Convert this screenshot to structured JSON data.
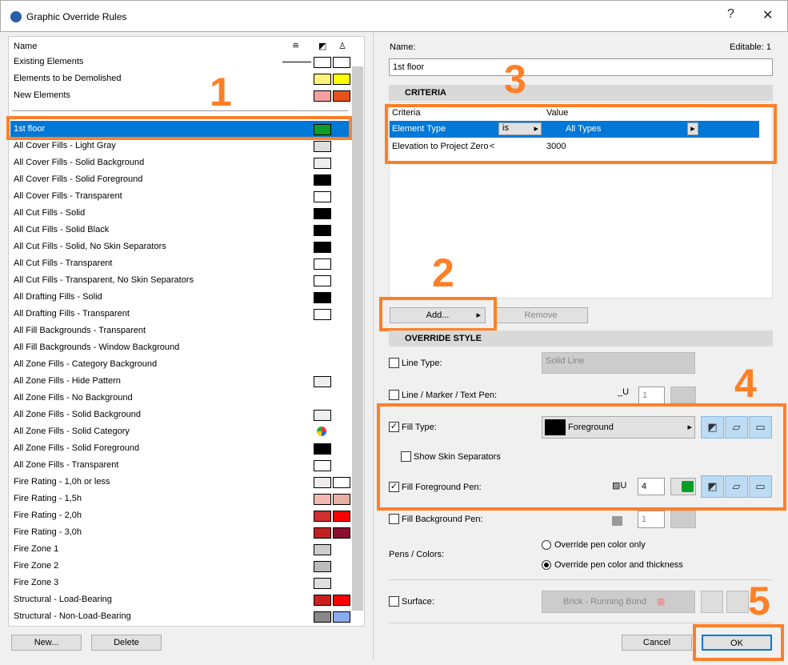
{
  "window": {
    "title": "Graphic Override Rules",
    "help": "?",
    "close": "✕"
  },
  "list": {
    "header": {
      "name": "Name"
    },
    "items": [
      {
        "label": "Existing Elements",
        "s1": "#ffffff",
        "s2": "#ffffff",
        "line": true
      },
      {
        "label": "Elements to be Demolished",
        "s1": "#fff27a",
        "s2": "#ffff00"
      },
      {
        "label": "New Elements",
        "s1": "#f5a0a0",
        "s2": "#e8521a"
      },
      {
        "label": "1st floor",
        "s1": "#0a9e28",
        "selected": true
      },
      {
        "label": "All Cover Fills - Light Gray",
        "s1": "#dddddd"
      },
      {
        "label": "All Cover Fills - Solid Background",
        "s1": "#eeeeee"
      },
      {
        "label": "All Cover Fills - Solid Foreground",
        "s1": "#000000"
      },
      {
        "label": "All Cover Fills - Transparent",
        "s1": "#ffffff"
      },
      {
        "label": "All Cut Fills - Solid",
        "s1": "#000000"
      },
      {
        "label": "All Cut Fills - Solid Black",
        "s1": "#000000"
      },
      {
        "label": "All Cut Fills - Solid, No Skin Separators",
        "s1": "#000000"
      },
      {
        "label": "All Cut Fills - Transparent",
        "s1": "#ffffff"
      },
      {
        "label": "All Cut Fills - Transparent, No Skin Separators",
        "s1": "#ffffff"
      },
      {
        "label": "All Drafting Fills - Solid",
        "s1": "#000000"
      },
      {
        "label": "All Drafting Fills - Transparent",
        "s1": "#ffffff"
      },
      {
        "label": "All Fill Backgrounds - Transparent"
      },
      {
        "label": "All Fill Backgrounds - Window Background"
      },
      {
        "label": "All Zone Fills - Category Background"
      },
      {
        "label": "All Zone Fills - Hide Pattern",
        "s1": "#eeeeee"
      },
      {
        "label": "All Zone Fills - No Background"
      },
      {
        "label": "All Zone Fills - Solid Background",
        "s1": "#eeeeee"
      },
      {
        "label": "All Zone Fills - Solid Category",
        "category": true
      },
      {
        "label": "All Zone Fills - Solid Foreground",
        "s1": "#000000"
      },
      {
        "label": "All Zone Fills - Transparent",
        "s1": "#ffffff"
      },
      {
        "label": "Fire Rating - 1,0h or less",
        "s1": "#eeeeee",
        "s2": "#ffffff"
      },
      {
        "label": "Fire Rating - 1,5h",
        "s1": "#f0b8b0",
        "s2": "#e8b0a0"
      },
      {
        "label": "Fire Rating - 2,0h",
        "s1": "#d03030",
        "s2": "#ff0000"
      },
      {
        "label": "Fire Rating - 3,0h",
        "s1": "#c02020",
        "s2": "#8b1030"
      },
      {
        "label": "Fire Zone 1",
        "s1": "#cccccc"
      },
      {
        "label": "Fire Zone 2",
        "s1": "#bbbbbb"
      },
      {
        "label": "Fire Zone 3",
        "s1": "#dddddd"
      },
      {
        "label": "Structural - Load-Bearing",
        "s1": "#c82020",
        "s2": "#ff0000"
      },
      {
        "label": "Structural - Non-Load-Bearing",
        "s1": "#888888",
        "s2": "#8aaaee"
      }
    ],
    "new": "New...",
    "delete": "Delete"
  },
  "detail": {
    "name_label": "Name:",
    "editable": "Editable: 1",
    "name_value": "1st floor",
    "criteria_header": "CRITERIA",
    "criteria_cols": [
      "Criteria",
      "Value"
    ],
    "criteria_rows": [
      {
        "criteria": "Element Type",
        "op": "is",
        "value": "All Types"
      },
      {
        "criteria": "Elevation to Project Zero",
        "op": "<",
        "value": "3000"
      }
    ],
    "add": "Add...",
    "remove": "Remove",
    "override_header": "OVERRIDE STYLE",
    "line_type": "Line Type:",
    "line_type_value": "Solid Line",
    "line_pen": "Line / Marker / Text Pen:",
    "line_pen_value": "1",
    "fill_type": "Fill Type:",
    "fill_type_value": "Foreground",
    "skin": "Show Skin Separators",
    "fill_fg": "Fill Foreground Pen:",
    "fill_fg_value": "4",
    "fill_bg": "Fill Background Pen:",
    "fill_bg_value": "1",
    "pens": "Pens / Colors:",
    "radio1": "Override pen color only",
    "radio2": "Override pen color and thickness",
    "surface": "Surface:",
    "surface_value": "Brick - Running Bond",
    "cancel": "Cancel",
    "ok": "OK"
  },
  "annotations": [
    "1",
    "2",
    "3",
    "4",
    "5"
  ],
  "colors": {
    "accent": "#ff7f27",
    "selection": "#0078d7",
    "pen_green": "#0a9e28"
  }
}
